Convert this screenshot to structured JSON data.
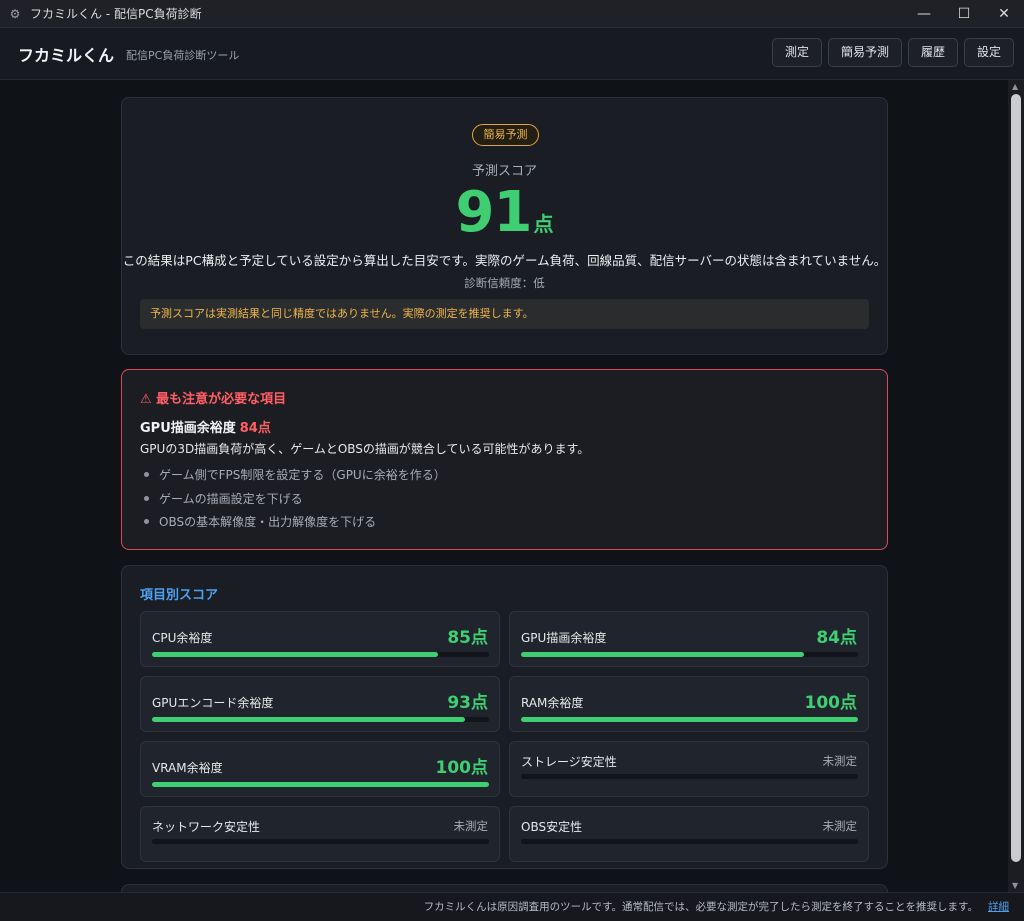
{
  "window": {
    "title": "フカミルくん - 配信PC負荷診断",
    "icon": "gear-icon",
    "controls": {
      "minimize": "—",
      "maximize": "☐",
      "close": "✕"
    }
  },
  "header": {
    "brand": "フカミルくん",
    "subtitle": "配信PC負荷診断ツール",
    "nav": [
      "測定",
      "簡易予測",
      "履歴",
      "設定"
    ]
  },
  "score": {
    "badge": "簡易予測",
    "label": "予測スコア",
    "value": "91",
    "unit": "点",
    "description": "この結果はPC構成と予定している設定から算出した目安です。実際のゲーム負荷、回線品質、配信サーバーの状態は含まれていません。",
    "reliability": "診断信頼度：低",
    "warning": "予測スコアは実測結果と同じ精度ではありません。実際の測定を推奨します。"
  },
  "alert": {
    "title": "⚠ 最も注意が必要な項目",
    "item_name": "GPU描画余裕度",
    "item_points": "84点",
    "description": "GPUの3D描画負荷が高く、ゲームとOBSの描画が競合している可能性があります。",
    "suggestions": [
      "ゲーム側でFPS制限を設定する（GPUに余裕を作る）",
      "ゲームの描画設定を下げる",
      "OBSの基本解像度・出力解像度を下げる"
    ]
  },
  "metrics": {
    "title": "項目別スコア",
    "items": [
      {
        "name": "CPU余裕度",
        "value": "85点",
        "progress": 0.85,
        "measured": true
      },
      {
        "name": "GPU描画余裕度",
        "value": "84点",
        "progress": 0.84,
        "measured": true
      },
      {
        "name": "GPUエンコード余裕度",
        "value": "93点",
        "progress": 0.93,
        "measured": true
      },
      {
        "name": "RAM余裕度",
        "value": "100点",
        "progress": 1.0,
        "measured": true
      },
      {
        "name": "VRAM余裕度",
        "value": "100点",
        "progress": 1.0,
        "measured": true
      },
      {
        "name": "ストレージ安定性",
        "value": "未測定",
        "progress": 0,
        "measured": false
      },
      {
        "name": "ネットワーク安定性",
        "value": "未測定",
        "progress": 0,
        "measured": false
      },
      {
        "name": "OBS安定性",
        "value": "未測定",
        "progress": 0,
        "measured": false
      }
    ]
  },
  "footer": {
    "text": "フカミルくんは原因調査用のツールです。通常配信では、必要な測定が完了したら測定を終了することを推奨します。",
    "link": "詳細"
  }
}
